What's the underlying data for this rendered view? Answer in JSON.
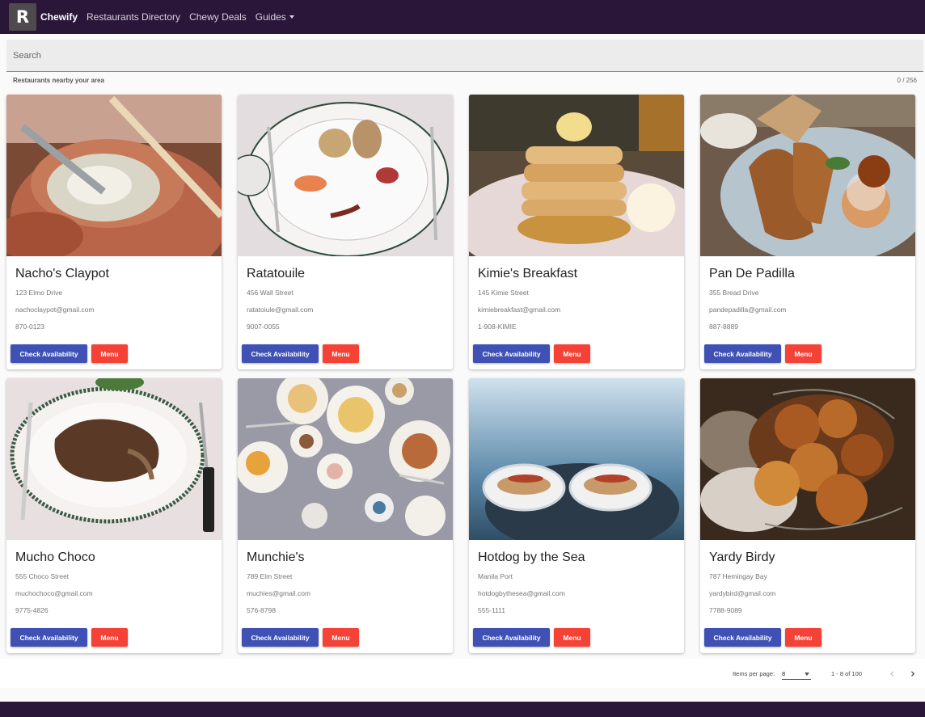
{
  "navbar": {
    "logo_text": "R",
    "brand": "Chewify",
    "links": [
      "Restaurants Directory",
      "Chewy Deals"
    ],
    "guides_label": "Guides",
    "background": "#2a1638"
  },
  "search": {
    "placeholder": "Search"
  },
  "hint": "Restaurants nearby your area",
  "counter": "0 / 256",
  "buttons": {
    "check": "Check Availability",
    "menu": "Menu",
    "check_color": "#3f51b5",
    "menu_color": "#f44336"
  },
  "restaurants": [
    {
      "name": "Nacho's Claypot",
      "address": "123 Elmo Drive",
      "email": "nachoclaypot@gmail.com",
      "phone": "870-0123",
      "image": "claypot noodle soup with chopsticks"
    },
    {
      "name": "Ratatouile",
      "address": "456 Wall Street",
      "email": "ratatoiule@gmail.com",
      "phone": "9007-0055",
      "image": "plated fine dining dish"
    },
    {
      "name": "Kimie's Breakfast",
      "address": "145 Kimie Street",
      "email": "kimiebreakfast@gmail.com",
      "phone": "1-908-KIMIE",
      "image": "pancake stack with butter"
    },
    {
      "name": "Pan De Padilla",
      "address": "355 Bread Drive",
      "email": "pandepadilla@gmail.com",
      "phone": "887-8889",
      "image": "chicken and waffles"
    },
    {
      "name": "Mucho Choco",
      "address": "555 Choco Street",
      "email": "muchochoco@gmail.com",
      "phone": "9775-4826",
      "image": "steak on oval plate"
    },
    {
      "name": "Munchie's",
      "address": "789 Elm Street",
      "email": "muchies@gmail.com",
      "phone": "576-8798",
      "image": "breakfast table spread"
    },
    {
      "name": "Hotdog by the Sea",
      "address": "Manila Port",
      "email": "hotdogbythesea@gmail.com",
      "phone": "555-1111",
      "image": "two plates by the sea"
    },
    {
      "name": "Yardy Birdy",
      "address": "787 Hemingay Bay",
      "email": "yardybird@gmail.com",
      "phone": "7788-9089",
      "image": "fried chicken basket"
    }
  ],
  "paginator": {
    "items_label": "Items per page:",
    "page_size": "8",
    "range": "1 - 8 of 100"
  }
}
